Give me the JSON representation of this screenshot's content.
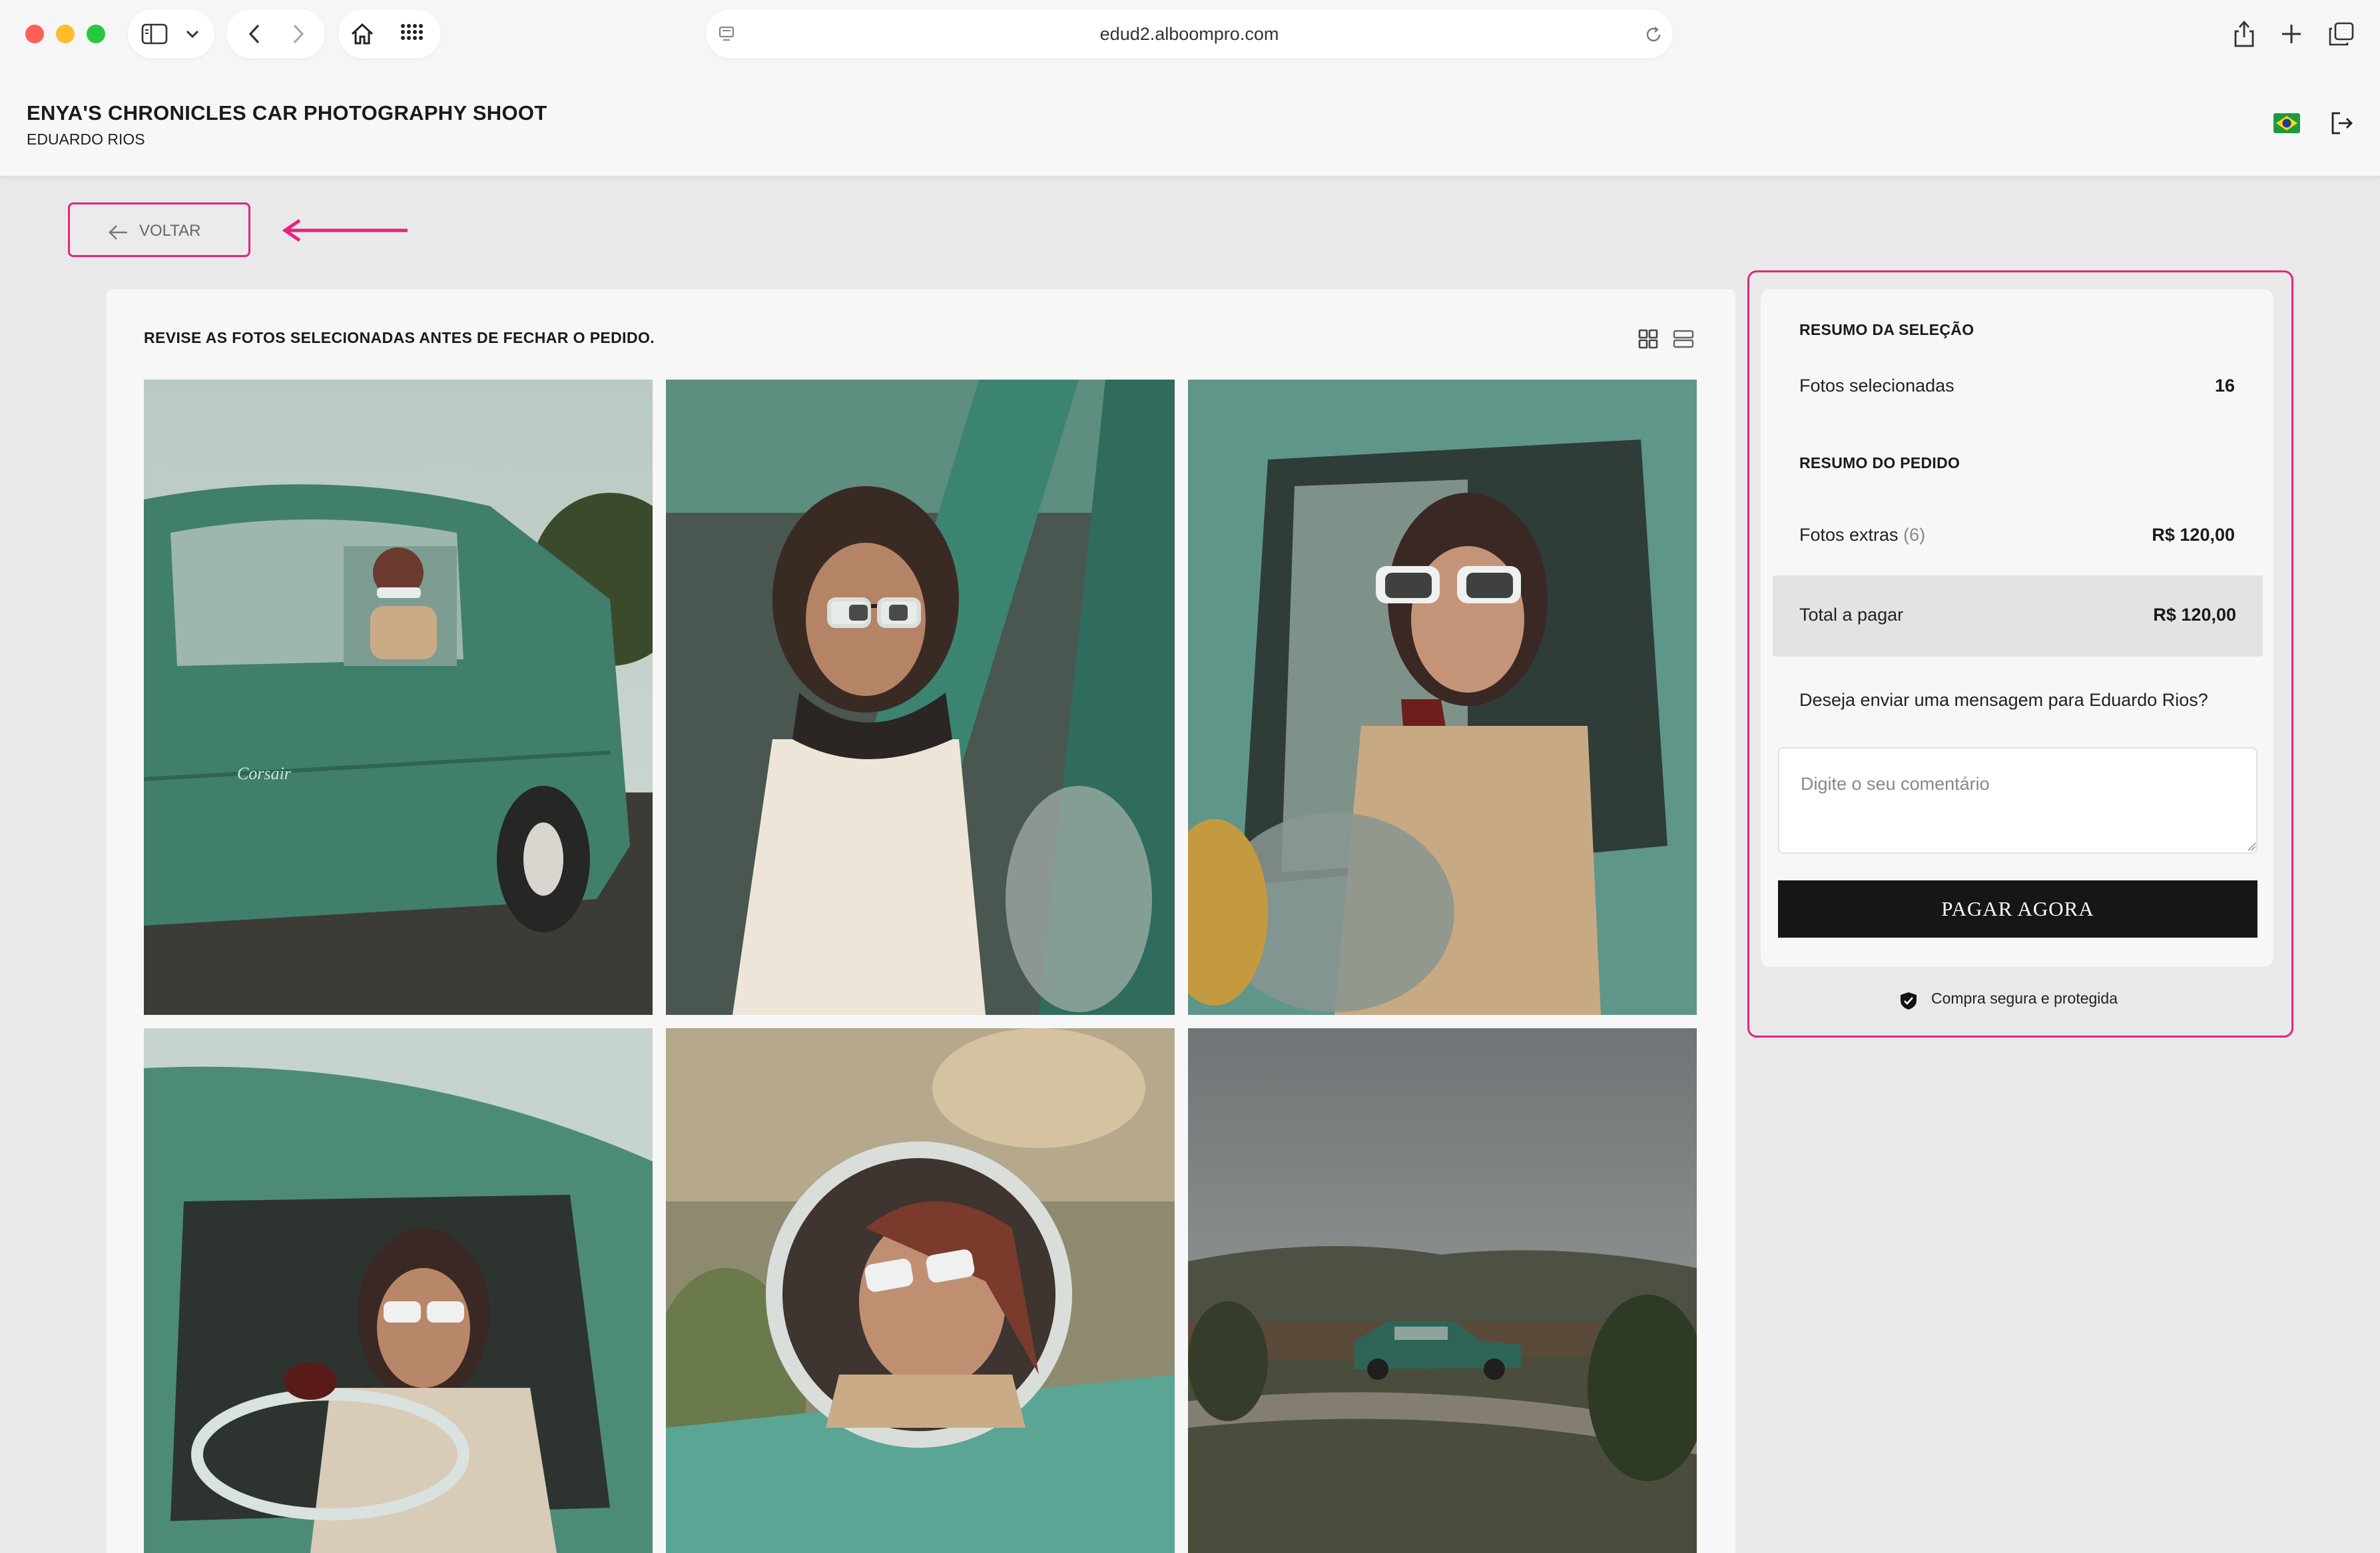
{
  "browser": {
    "url": "edud2.alboompro.com"
  },
  "header": {
    "gallery_title": "ENYA'S CHRONICLES CAR PHOTOGRAPHY SHOOT",
    "photographer": "EDUARDO RIOS"
  },
  "back_button": {
    "label": "VOLTAR"
  },
  "review": {
    "instruction": "REVISE AS FOTOS SELECIONADAS ANTES DE FECHAR O PEDIDO.",
    "photos": [
      "green vintage car, woman leaning out window",
      "woman in headscarf and white sunglasses behind wheel",
      "woman in car applying lipstick",
      "woman at wheel of green car",
      "woman reflected in round side mirror",
      "green vintage car on rural road"
    ]
  },
  "summary": {
    "selection_title": "RESUMO DA SELEÇÃO",
    "selected_label": "Fotos selecionadas",
    "selected_count": "16",
    "order_title": "RESUMO DO PEDIDO",
    "extras_label": "Fotos extras",
    "extras_count": "(6)",
    "extras_value": "R$ 120,00",
    "total_label": "Total a pagar",
    "total_value": "R$ 120,00",
    "message_prompt": "Deseja enviar uma mensagem para Eduardo Rios?",
    "comment_placeholder": "Digite o seu comentário",
    "pay_button": "PAGAR AGORA",
    "secure_text": "Compra segura e protegida"
  },
  "colors": {
    "highlight": "#e4257f",
    "teal_car": "#4f8f7d",
    "pay_button": "#161616"
  }
}
